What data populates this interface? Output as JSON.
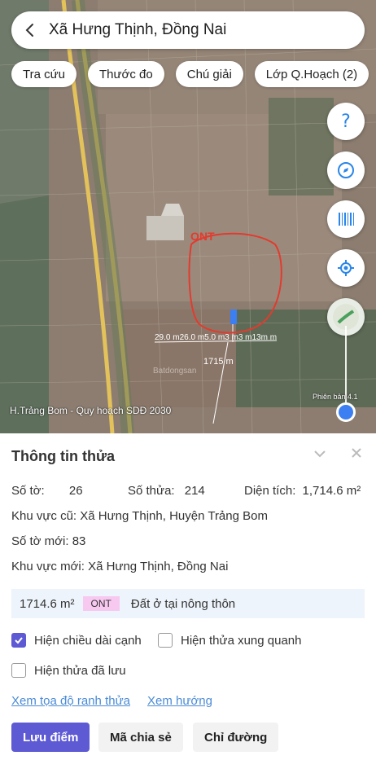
{
  "header": {
    "title": "Xã Hưng Thịnh, Đồng Nai"
  },
  "chips": [
    "Tra cứu",
    "Thước đo",
    "Chú giải",
    "Lớp Q.Hoạch (2)"
  ],
  "map": {
    "ont_label": "ONT",
    "dim_top": "29.0 m26.0 m5.0 m3 m3 m13m m",
    "dim_mid": "1715 m",
    "footer": "H.Trảng Bom - Quy hoạch SDĐ 2030",
    "version": "Phiên bản 4.1",
    "watermark": "Batdongsan"
  },
  "panel": {
    "title": "Thông tin thửa",
    "so_to_label": "Số tờ:",
    "so_to_value": "26",
    "so_thua_label": "Số thửa:",
    "so_thua_value": "214",
    "dien_tich_label": "Diện tích:",
    "dien_tich_value": "1,714.6 m²",
    "khu_vuc_cu_label": "Khu vực cũ:",
    "khu_vuc_cu_value": "Xã Hưng Thịnh, Huyện Trảng Bom",
    "so_to_moi_label": "Số tờ mới:",
    "so_to_moi_value": "83",
    "khu_vuc_moi_label": "Khu vực mới:",
    "khu_vuc_moi_value": "Xã Hưng Thịnh, Đồng Nai",
    "area_value": "1714.6 m²",
    "ont_tag": "ONT",
    "land_use": "Đất ở tại nông thôn"
  },
  "checks": {
    "show_edge_length": "Hiện chiều dài cạnh",
    "show_neighbors": "Hiện thửa xung quanh",
    "show_saved": "Hiện thửa đã lưu"
  },
  "links": {
    "coords": "Xem tọa độ ranh thửa",
    "direction": "Xem hướng"
  },
  "buttons": {
    "save": "Lưu điểm",
    "share": "Mã chia sẻ",
    "route": "Chỉ đường"
  },
  "colors": {
    "accent": "#5d5ad4",
    "link": "#4b8bd6",
    "plot_outline": "#e23b2e",
    "ont_tag_bg": "#f7c8f0"
  }
}
